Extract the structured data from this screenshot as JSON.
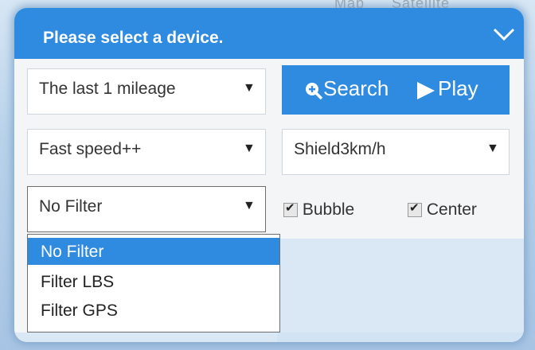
{
  "map": {
    "top_labels": [
      "Map",
      "Satellite"
    ]
  },
  "panel": {
    "title": "Please select a device.",
    "collapse_icon": "chevron-down-icon"
  },
  "range_select": {
    "value": "The last 1 mileage"
  },
  "search_button": {
    "search_label": "Search",
    "play_label": "Play",
    "search_icon": "zoom-in-icon",
    "play_icon": "play-icon"
  },
  "speed_select": {
    "value": "Fast speed++"
  },
  "shield_select": {
    "value": "Shield3km/h"
  },
  "filter_select": {
    "value": "No Filter",
    "options": [
      "No Filter",
      "Filter LBS",
      "Filter GPS"
    ]
  },
  "checkboxes": {
    "bubble": {
      "label": "Bubble",
      "checked": true
    },
    "center": {
      "label": "Center",
      "checked": true
    }
  },
  "colors": {
    "accent": "#2f8be0",
    "panel_bg": "#f3f5f7",
    "selected": "#2f8be0"
  }
}
